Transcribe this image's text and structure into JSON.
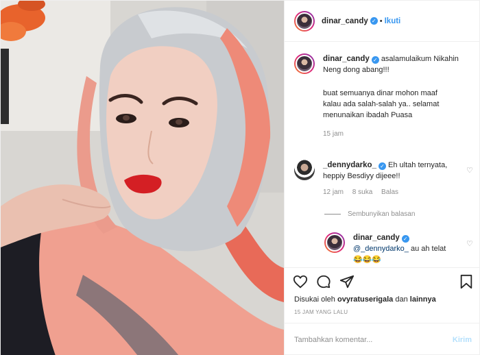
{
  "header": {
    "username": "dinar_candy",
    "separator": "•",
    "follow_label": "Ikuti"
  },
  "caption": {
    "username": "dinar_candy",
    "text1": "asalamulaikum Nikahin Neng dong abang!!!",
    "text2": "buat semuanya dinar mohon maaf kalau ada salah-salah ya.. selamat menunaikan ibadah Puasa",
    "time": "15 jam"
  },
  "comments": [
    {
      "username": "_dennydarko_",
      "text": "Eh ultah ternyata, heppiy Besdiyy dijeee!!",
      "time": "12 jam",
      "likes": "8 suka",
      "reply_label": "Balas"
    }
  ],
  "hide_replies_label": "Sembunyikan balasan",
  "reply": {
    "username": "dinar_candy",
    "mention": "@_dennydarko_",
    "text": "au ah telat 😂😂😂"
  },
  "actions": {
    "liked_by_prefix": "Disukai oleh",
    "liked_by_user": "ovyratuserigala",
    "liked_by_and": "dan",
    "liked_by_others": "lainnya",
    "time_ago": "15 JAM YANG LALU"
  },
  "compose": {
    "placeholder": "Tambahkan komentar...",
    "send_label": "Kirim"
  },
  "colors": {
    "link_blue": "#3897f0",
    "muted_gray": "#8e8e8e",
    "send_disabled": "#b2dffc"
  },
  "icons": [
    "verified-badge-icon",
    "heart-icon",
    "comment-icon",
    "share-icon",
    "bookmark-icon"
  ]
}
